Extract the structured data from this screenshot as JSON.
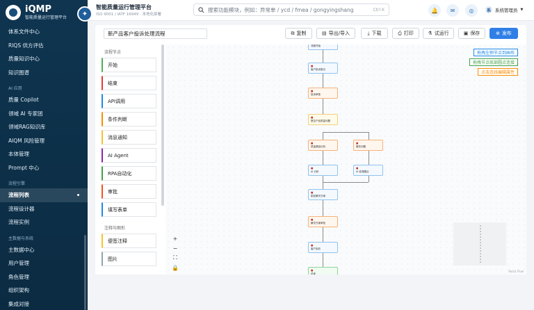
{
  "app": {
    "name": "iQMP",
    "subtitle": "智能质量运行管理平台",
    "title": "智能质量运行管理平台",
    "title_sub": "ISO 9001 / IATF 16949 · 本地化部署"
  },
  "sidebar": {
    "items": [
      {
        "type": "item",
        "label": "体系文件中心"
      },
      {
        "type": "item",
        "label": "RIQS 供方评估"
      },
      {
        "type": "item",
        "label": "质量知识中心"
      },
      {
        "type": "item",
        "label": "知识图谱"
      },
      {
        "type": "group",
        "label": "AI 应用"
      },
      {
        "type": "item",
        "label": "质量 Copilot"
      },
      {
        "type": "item",
        "label": "领域 AI 专家团"
      },
      {
        "type": "item",
        "label": "领域RAG知识库"
      },
      {
        "type": "item",
        "label": "AIQM 风险管理"
      },
      {
        "type": "item",
        "label": "本体管理"
      },
      {
        "type": "item",
        "label": "Prompt 中心"
      },
      {
        "type": "group",
        "label": "流程引擎"
      },
      {
        "type": "item",
        "label": "流程列表",
        "active": true
      },
      {
        "type": "item",
        "label": "流程设计器"
      },
      {
        "type": "item",
        "label": "流程实例"
      },
      {
        "type": "group",
        "label": "主数据与系统"
      },
      {
        "type": "item",
        "label": "主数据中心"
      },
      {
        "type": "item",
        "label": "用户管理"
      },
      {
        "type": "item",
        "label": "角色管理"
      },
      {
        "type": "item",
        "label": "组织架构"
      },
      {
        "type": "item",
        "label": "集成对接"
      }
    ]
  },
  "search": {
    "placeholder": "搜索功能模块，例如：异常单 / ycd / fmea / gongyingshang",
    "shortcut": "Ctrl K"
  },
  "user": {
    "initial": "系",
    "name": "系统管理员"
  },
  "editor": {
    "flow_name": "新产品客户投诉处理流程",
    "toolbar": {
      "copy": "复制",
      "import_export": "导出/导入",
      "download": "下载",
      "print": "打印",
      "trial": "试运行",
      "save": "保存",
      "publish": "发布"
    }
  },
  "palette": {
    "section1": "流程节点",
    "nodes": [
      {
        "label": "开始",
        "color": "#4caf50"
      },
      {
        "label": "结束",
        "color": "#e53935"
      },
      {
        "label": "API调用",
        "color": "#1e88e5"
      },
      {
        "label": "条件判断",
        "color": "#fb8c00"
      },
      {
        "label": "消息通知",
        "color": "#fbc02d"
      },
      {
        "label": "AI Agent",
        "color": "#8e24aa"
      },
      {
        "label": "RPA自动化",
        "color": "#43a047"
      },
      {
        "label": "审批",
        "color": "#f4511e"
      },
      {
        "label": "填写表单",
        "color": "#1e88e5"
      }
    ],
    "section2": "注释与图形",
    "shapes": [
      {
        "label": "便签注释",
        "color": "#fbc02d"
      },
      {
        "label": "图片",
        "color": "#90a4ae"
      }
    ]
  },
  "legend": [
    {
      "text": "拖拽左侧节点到画布",
      "color": "#1e88e5"
    },
    {
      "text": "拖拽节点底部圆点连接",
      "color": "#43a047"
    },
    {
      "text": "点击连线编辑属性",
      "color": "#fb8c00"
    }
  ],
  "flow_nodes": [
    {
      "label": "流程开始",
      "kind": "blue"
    },
    {
      "label": "客户投诉登记",
      "kind": "blue"
    },
    {
      "label": "投诉审核",
      "kind": "orange"
    },
    {
      "label": "是否产品质量问题",
      "kind": "yellow"
    },
    {
      "label": "质量原因分析",
      "kind": "orange"
    },
    {
      "label": "服务问题",
      "kind": "orange"
    },
    {
      "label": "AI 分析",
      "kind": "blue"
    },
    {
      "label": "AI 处理建议",
      "kind": "blue"
    },
    {
      "label": "制定解决方案",
      "kind": "blue"
    },
    {
      "label": "解决方案审批",
      "kind": "orange"
    },
    {
      "label": "客户回访",
      "kind": "blue"
    },
    {
      "label": "结束",
      "kind": "green"
    }
  ],
  "canvas": {
    "attribution": "React Flow"
  },
  "colors": {
    "sidebar": "#0f3550",
    "primary": "#2f7fe6"
  }
}
